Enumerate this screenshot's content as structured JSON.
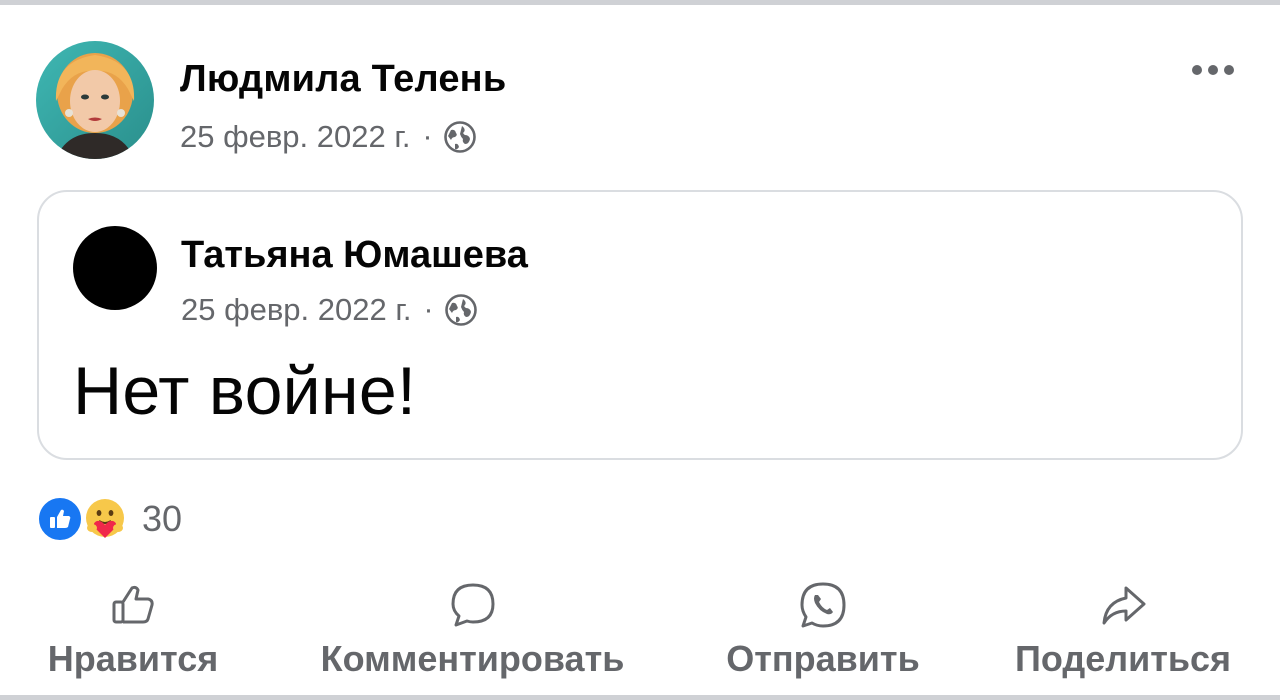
{
  "post": {
    "author": "Людмила Телень",
    "date": "25 февр. 2022 г.",
    "separator": "·",
    "privacy_icon": "globe-icon",
    "more_icon": "more-options-icon"
  },
  "shared_post": {
    "author": "Татьяна Юмашева",
    "date": "25 февр. 2022 г.",
    "separator": "·",
    "privacy_icon": "globe-icon",
    "text": "Нет войне!"
  },
  "reactions": {
    "types": [
      "like-icon",
      "care-icon"
    ],
    "count": "30"
  },
  "actions": {
    "like": "Нравится",
    "comment": "Комментировать",
    "send": "Отправить",
    "share": "Поделиться"
  },
  "colors": {
    "like_blue": "#1877f2",
    "secondary_text": "#65676b",
    "primary_text": "#050505",
    "card_border": "#dadde1"
  }
}
